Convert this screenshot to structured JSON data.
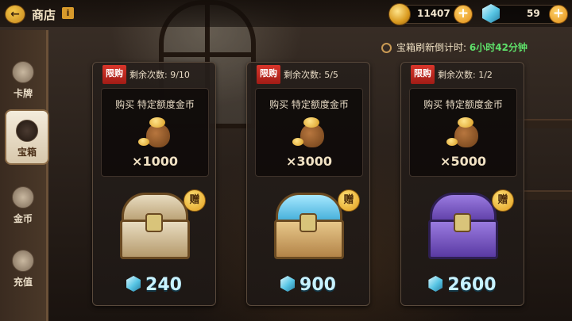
{
  "header": {
    "title": "商店",
    "info_icon": "i",
    "gold": "11407",
    "gems": "59",
    "plus": "+"
  },
  "sidebar": {
    "items": [
      {
        "label": "卡牌",
        "icon": "cards-icon",
        "active": false
      },
      {
        "label": "宝箱",
        "icon": "chest-icon",
        "active": true
      },
      {
        "label": "金币",
        "icon": "coin-icon",
        "active": false
      },
      {
        "label": "充值",
        "icon": "recharge-icon",
        "active": false
      }
    ]
  },
  "refresh": {
    "label": "宝箱刷新倒计时:",
    "time": "6小时42分钟"
  },
  "cards": [
    {
      "limit_tag": "限购",
      "remaining": "剩余次数: 9/10",
      "bonus_title": "购买 特定额度金币",
      "bonus_qty": "×1000",
      "gift": "赠",
      "price": "240",
      "chest": "wood"
    },
    {
      "limit_tag": "限购",
      "remaining": "剩余次数: 5/5",
      "bonus_title": "购买 特定额度金币",
      "bonus_qty": "×3000",
      "gift": "赠",
      "price": "900",
      "chest": "ice"
    },
    {
      "limit_tag": "限购",
      "remaining": "剩余次数: 1/2",
      "bonus_title": "购买 特定额度金币",
      "bonus_qty": "×5000",
      "gift": "赠",
      "price": "2600",
      "chest": "purple"
    }
  ],
  "colors": {
    "timer": "#5ee06a",
    "limit_tag": "#d8362b",
    "price": "#c8f2ff"
  }
}
